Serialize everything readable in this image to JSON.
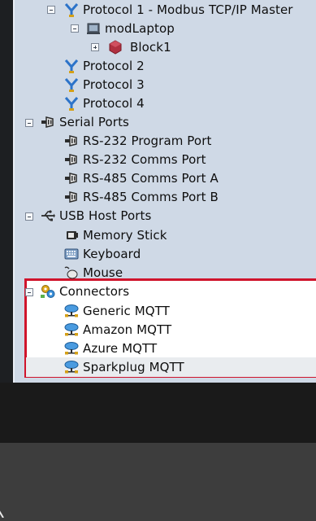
{
  "tree": {
    "protocol1": "Protocol 1 - Modbus TCP/IP Master",
    "modlaptop": "modLaptop",
    "block1": "Block1",
    "protocol2": "Protocol 2",
    "protocol3": "Protocol 3",
    "protocol4": "Protocol 4",
    "serial_ports": "Serial Ports",
    "serial_items": [
      "RS-232 Program Port",
      "RS-232 Comms Port",
      "RS-485 Comms Port A",
      "RS-485 Comms Port B"
    ],
    "usb_host_ports": "USB Host Ports",
    "usb_items": [
      "Memory Stick",
      "Keyboard",
      "Mouse"
    ],
    "connectors": "Connectors",
    "connector_items": [
      "Generic MQTT",
      "Amazon MQTT",
      "Azure MQTT",
      "Sparkplug MQTT"
    ]
  },
  "icons": {
    "protocol": "network-branch-icon",
    "device": "laptop-icon",
    "block": "cube-block-icon",
    "serial": "serial-port-icon",
    "usb": "usb-icon",
    "memory": "memory-stick-icon",
    "keyboard": "keyboard-icon",
    "mouse": "mouse-icon",
    "connectors": "gears-icon",
    "cloud": "cloud-network-icon"
  },
  "colors": {
    "tree_bg": "#cfd9e6",
    "highlight_border": "#d0142c",
    "row_hover": "#e9ecef"
  }
}
